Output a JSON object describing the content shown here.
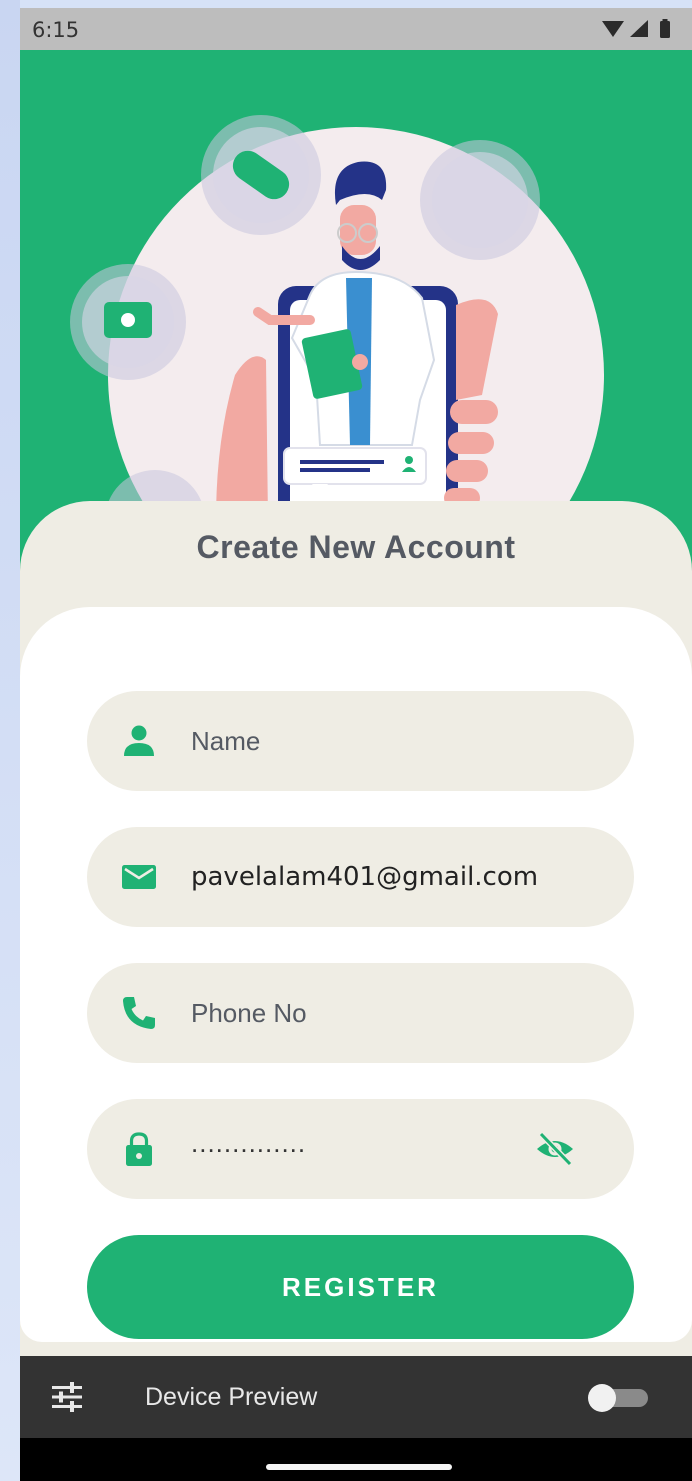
{
  "status_bar": {
    "time": "6:15"
  },
  "form": {
    "title": "Create New Account",
    "name_placeholder": "Name",
    "email_value": "pavelalam401@gmail.com",
    "phone_placeholder": "Phone No",
    "password_value": "..............",
    "register_label": "REGISTER"
  },
  "device_preview": {
    "label": "Device Preview",
    "enabled": false
  },
  "colors": {
    "brand": "#1fb274",
    "field_bg": "#efede4",
    "text": "#555a63"
  }
}
